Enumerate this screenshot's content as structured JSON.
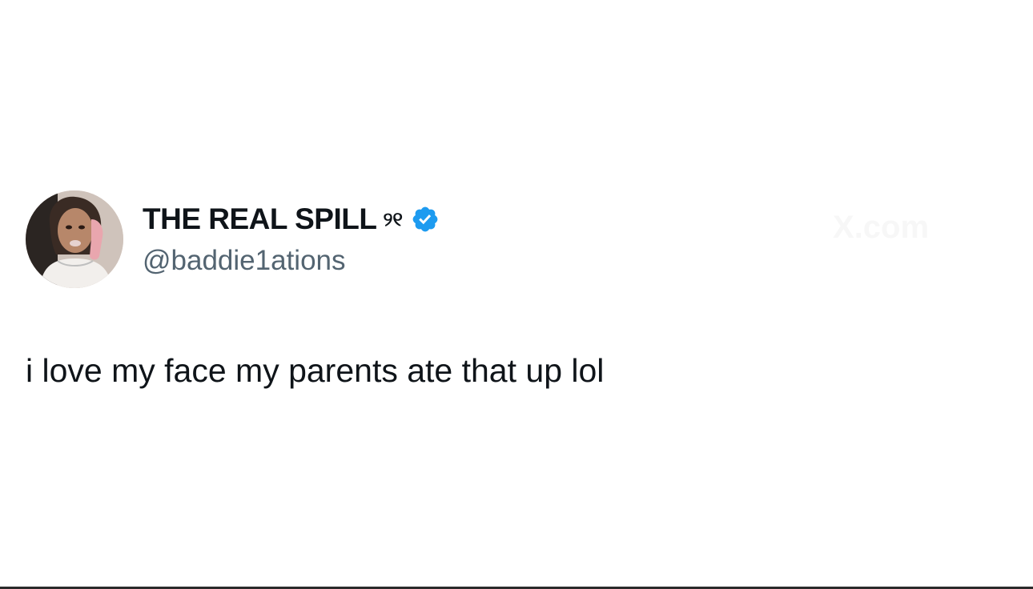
{
  "tweet": {
    "display_name": "THE REAL SPILL",
    "name_emoji": "୨୧",
    "verified_icon": "verified-badge-icon",
    "handle": "@baddie1ations",
    "text": "i love my face my parents ate that up lol",
    "watermark": "X.com"
  },
  "colors": {
    "background": "#ffffff",
    "text_primary": "#0f1419",
    "text_secondary": "#536471",
    "verified_blue": "#1d9bf0"
  }
}
